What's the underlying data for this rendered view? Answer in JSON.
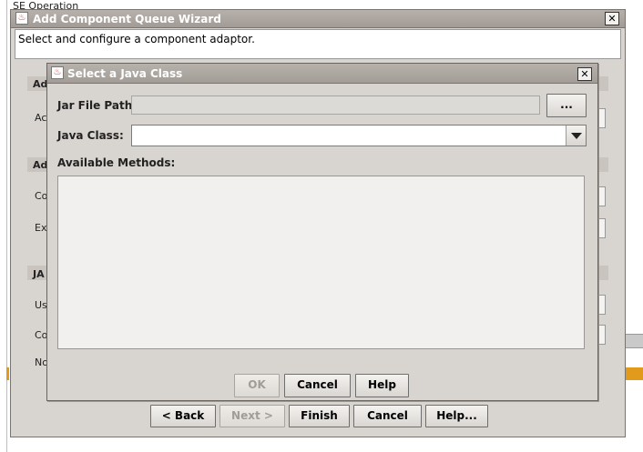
{
  "background": {
    "text": "SE Operation"
  },
  "wizard": {
    "title": "Add Component Queue Wizard",
    "banner": "Select and configure a component adaptor.",
    "fragments": {
      "ad1": "Ad",
      "a1": "Ac",
      "ad2": "Ad",
      "co1": "Co",
      "ex": "Ex",
      "ja": "JA",
      "us": "Us",
      "co2": "Co",
      "no": "No"
    },
    "buttons": {
      "back": "< Back",
      "next": "Next >",
      "finish": "Finish",
      "cancel": "Cancel",
      "help": "Help..."
    }
  },
  "dialog": {
    "title": "Select a Java Class",
    "jar_label": "Jar File Path:",
    "jar_value": "",
    "browse": "...",
    "class_label": "Java Class:",
    "class_value": "",
    "methods_label": "Available Methods:",
    "buttons": {
      "ok": "OK",
      "cancel": "Cancel",
      "help": "Help"
    }
  },
  "icons": {
    "window": "java-cup-icon",
    "close": "close-icon"
  }
}
